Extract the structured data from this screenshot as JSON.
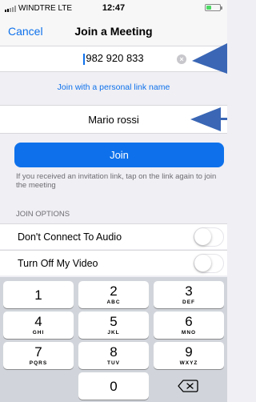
{
  "status": {
    "carrier": "WINDTRE LTE",
    "time": "12:47",
    "battery_color": "#4cd964"
  },
  "nav": {
    "cancel": "Cancel",
    "title": "Join a Meeting"
  },
  "meeting_id": {
    "value": "982 920 833",
    "clear_icon": "clear-circle-icon"
  },
  "personal_link": "Join with a personal link name",
  "display_name": {
    "value": "Mario rossi"
  },
  "join_button": "Join",
  "hint": "If you received an invitation link, tap on the link again to join the meeting",
  "options": {
    "header": "JOIN OPTIONS",
    "items": [
      {
        "label": "Don't Connect To Audio",
        "enabled": false
      },
      {
        "label": "Turn Off My Video",
        "enabled": false
      }
    ]
  },
  "keypad": {
    "keys": [
      {
        "digit": "1",
        "letters": ""
      },
      {
        "digit": "2",
        "letters": "ABC"
      },
      {
        "digit": "3",
        "letters": "DEF"
      },
      {
        "digit": "4",
        "letters": "GHI"
      },
      {
        "digit": "5",
        "letters": "JKL"
      },
      {
        "digit": "6",
        "letters": "MNO"
      },
      {
        "digit": "7",
        "letters": "PQRS"
      },
      {
        "digit": "8",
        "letters": "TUV"
      },
      {
        "digit": "9",
        "letters": "WXYZ"
      },
      {
        "digit": "0",
        "letters": ""
      }
    ],
    "delete_icon": "backspace-icon"
  },
  "colors": {
    "accent": "#0e71eb",
    "annotation_arrow": "#3a66b5"
  }
}
